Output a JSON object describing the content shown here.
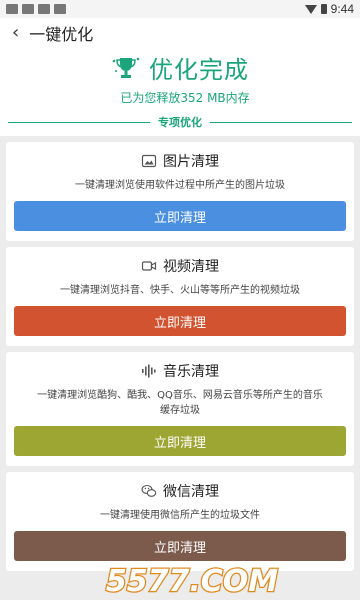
{
  "status_bar": {
    "time": "9:44"
  },
  "header": {
    "title": "一键优化"
  },
  "hero": {
    "title": "优化完成",
    "subtitle": "已为您释放352 MB内存"
  },
  "section": {
    "title": "专项优化"
  },
  "cards": [
    {
      "title": "图片清理",
      "desc": "一键清理浏览使用软件过程中所产生的图片垃圾",
      "button": "立即清理",
      "color": "#4a8fe0"
    },
    {
      "title": "视频清理",
      "desc": "一键清理浏览抖音、快手、火山等等所产生的视频垃圾",
      "button": "立即清理",
      "color": "#d2532f"
    },
    {
      "title": "音乐清理",
      "desc": "一键清理浏览酷狗、酷我、QQ音乐、网易云音乐等所产生的音乐缓存垃圾",
      "button": "立即清理",
      "color": "#9da533"
    },
    {
      "title": "微信清理",
      "desc": "一键清理使用微信所产生的垃圾文件",
      "button": "立即清理",
      "color": "#7c5a4c"
    }
  ],
  "watermark": {
    "text": "5577.COM"
  },
  "colors": {
    "accent": "#1aa67a"
  }
}
